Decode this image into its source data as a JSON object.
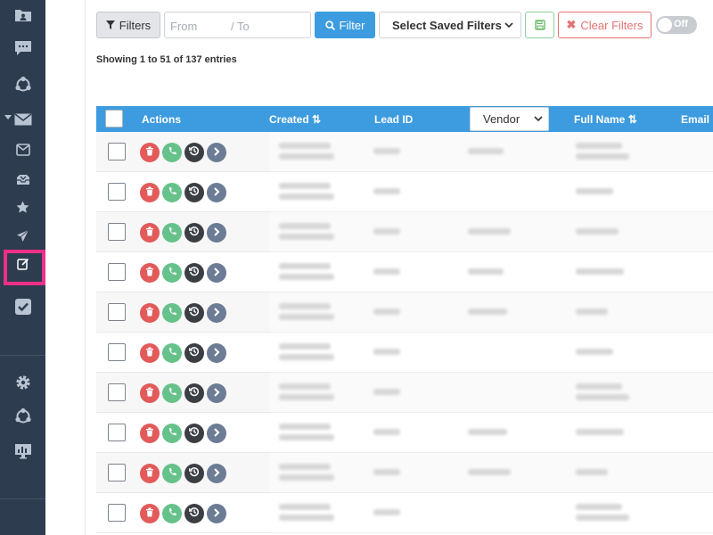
{
  "toolbar": {
    "filters_label": "Filters",
    "date_from_placeholder": "From",
    "date_to_placeholder": "To",
    "filter_button_label": "Filter",
    "saved_filters_label": "Select Saved Filters",
    "clear_filters_label": "Clear Filters",
    "toggle_label": "Off"
  },
  "summary": {
    "entries_text": "Showing 1 to 51 of 137 entries"
  },
  "table": {
    "columns": {
      "actions": "Actions",
      "created": "Created",
      "lead_id": "Lead ID",
      "vendor": "Vendor",
      "full_name": "Full Name",
      "email": "Email"
    },
    "row_count_visible": 10
  },
  "sidebar": {
    "icons": [
      "folder-user-icon",
      "chat-icon",
      "share-icon",
      "mail-icon",
      "inbox-icon",
      "mailbox-icon",
      "star-icon",
      "send-icon",
      "edit-icon",
      "checkbox-icon",
      "gear-icon",
      "share-icon",
      "monitor-chart-icon"
    ],
    "active_item": "edit-icon"
  },
  "colors": {
    "sidebar_bg": "#2e3c4f",
    "accent_blue": "#3d9cdf",
    "highlight_pink": "#ee2f8a",
    "delete_red": "#e25a5a",
    "call_green": "#66c28a"
  }
}
